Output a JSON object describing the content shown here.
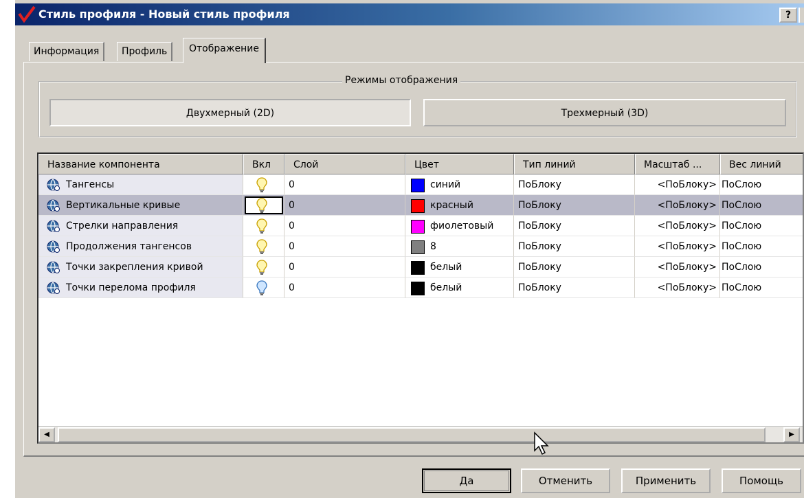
{
  "window": {
    "title": "Стиль профиля - Новый стиль профиля",
    "help_label": "?"
  },
  "tabs": [
    {
      "label": "Информация",
      "active": false
    },
    {
      "label": "Профиль",
      "active": false
    },
    {
      "label": "Отображение",
      "active": true
    }
  ],
  "display_modes": {
    "legend": "Режимы отображения",
    "mode_2d": "Двухмерный (2D)",
    "mode_3d": "Трехмерный (3D)",
    "selected": "2D"
  },
  "grid": {
    "columns": [
      "Название компонента",
      "Вкл",
      "Слой",
      "Цвет",
      "Тип линий",
      "Масштаб ...",
      "Вес линий"
    ],
    "rows": [
      {
        "name": "Тангенсы",
        "on": true,
        "layer": "0",
        "color_name": "синий",
        "color": "#0000ff",
        "linetype": "ПоБлоку",
        "scale": "<ПоБлоку>",
        "lineweight": "ПоСлою",
        "selected": false
      },
      {
        "name": "Вертикальные кривые",
        "on": true,
        "layer": "0",
        "color_name": "красный",
        "color": "#ff0000",
        "linetype": "ПоБлоку",
        "scale": "<ПоБлоку>",
        "lineweight": "ПоСлою",
        "selected": true
      },
      {
        "name": "Стрелки направления",
        "on": true,
        "layer": "0",
        "color_name": "фиолетовый",
        "color": "#ff00ff",
        "linetype": "ПоБлоку",
        "scale": "<ПоБлоку>",
        "lineweight": "ПоСлою",
        "selected": false
      },
      {
        "name": "Продолжения тангенсов",
        "on": true,
        "layer": "0",
        "color_name": "8",
        "color": "#808080",
        "linetype": "ПоБлоку",
        "scale": "<ПоБлоку>",
        "lineweight": "ПоСлою",
        "selected": false
      },
      {
        "name": "Точки закрепления кривой",
        "on": true,
        "layer": "0",
        "color_name": "белый",
        "color": "#000000",
        "linetype": "ПоБлоку",
        "scale": "<ПоБлоку>",
        "lineweight": "ПоСлою",
        "selected": false
      },
      {
        "name": "Точки перелома профиля",
        "on": false,
        "layer": "0",
        "color_name": "белый",
        "color": "#000000",
        "linetype": "ПоБлоку",
        "scale": "<ПоБлоку>",
        "lineweight": "ПоСлою",
        "selected": false
      }
    ]
  },
  "buttons": {
    "ok": "Да",
    "cancel": "Отменить",
    "apply": "Применить",
    "help": "Помощь"
  },
  "icons": {
    "app": "autodesk-check-icon",
    "row": "component-globe-icon",
    "on": "lightbulb-on-icon",
    "off": "lightbulb-off-icon"
  }
}
